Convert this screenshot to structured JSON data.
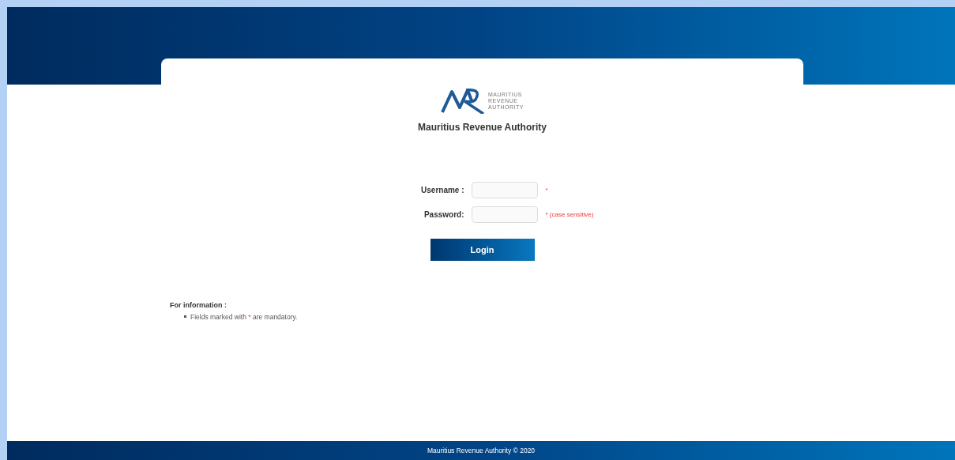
{
  "logo": {
    "lines": [
      "MAURITIUS",
      "REVENUE",
      "AUTHORITY"
    ]
  },
  "title": "Mauritius Revenue Authority",
  "fields": [
    {
      "label": "Username :",
      "required_mark": "*"
    },
    {
      "label": "Password:",
      "required_mark": "*",
      "note": "(case sensitive)"
    }
  ],
  "login_button": "Login",
  "info": {
    "heading": "For information :",
    "items": [
      {
        "before": "Fields marked with",
        "mark": "*",
        "after": "are mandatory."
      }
    ]
  },
  "footer": "Mauritius Revenue Authority © 2020"
}
